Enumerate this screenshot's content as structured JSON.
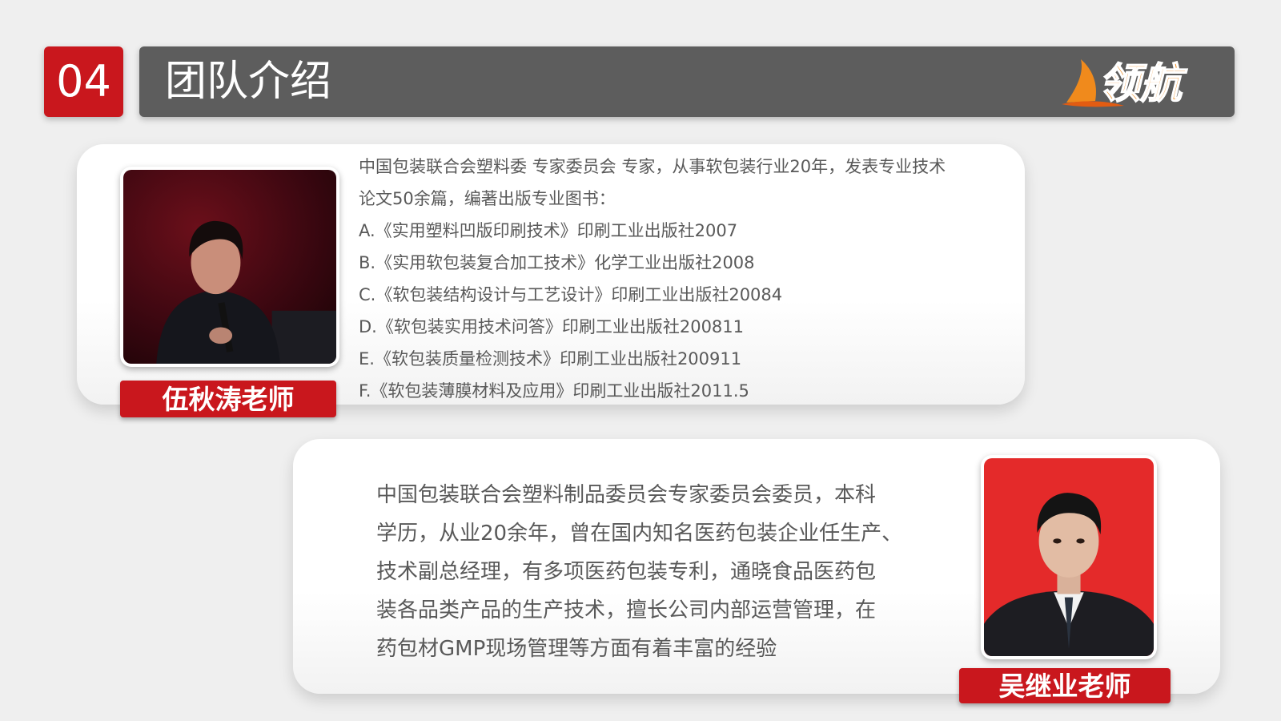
{
  "header": {
    "section_number": "04",
    "title": "团队介绍",
    "logo_text": "领航"
  },
  "colors": {
    "accent_red": "#c9171d",
    "header_gray": "#5d5d5d",
    "logo_orange": "#f08a1c"
  },
  "members": [
    {
      "name": "伍秋涛老师",
      "photo_icon": "speaker-photo-icon",
      "bio_lines": [
        "中国包装联合会塑料委 专家委员会 专家，从事软包装行业20年，发表专业技术",
        "论文50余篇，编著出版专业图书：",
        "A.《实用塑料凹版印刷技术》印刷工业出版社2007",
        "B.《实用软包装复合加工技术》化学工业出版社2008",
        "C.《软包装结构设计与工艺设计》印刷工业出版社20084",
        "D.《软包装实用技术问答》印刷工业出版社200811",
        "E.《软包装质量检测技术》印刷工业出版社200911",
        "F.《软包装薄膜材料及应用》印刷工业出版社2011.5"
      ]
    },
    {
      "name": "吴继业老师",
      "photo_icon": "portrait-photo-icon",
      "bio_lines": [
        "中国包装联合会塑料制品委员会专家委员会委员，本科",
        "学历，从业20余年，曾在国内知名医药包装企业任生产、",
        "技术副总经理，有多项医药包装专利，通晓食品医药包",
        "装各品类产品的生产技术，擅长公司内部运营管理，在",
        "药包材GMP现场管理等方面有着丰富的经验"
      ]
    }
  ]
}
